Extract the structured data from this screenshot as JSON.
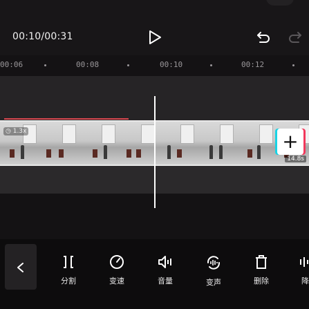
{
  "player": {
    "timecode": "00:10/00:31"
  },
  "ruler": {
    "labels": [
      "00:06",
      "00:08",
      "00:10",
      "00:12"
    ]
  },
  "clip": {
    "speed": "1.3x",
    "duration": "14.8s"
  },
  "toolbar": {
    "tools": [
      {
        "label": "分割",
        "icon": "split-icon"
      },
      {
        "label": "变速",
        "icon": "speed-icon"
      },
      {
        "label": "音量",
        "icon": "volume-icon"
      },
      {
        "label": "变声",
        "icon": "voice-change-icon"
      },
      {
        "label": "删除",
        "icon": "delete-icon"
      },
      {
        "label": "降",
        "icon": "noise-reduce-icon"
      }
    ]
  },
  "colors": {
    "accent_red": "#d8484f",
    "cyan": "#19d3e4",
    "pink": "#f2375b"
  }
}
